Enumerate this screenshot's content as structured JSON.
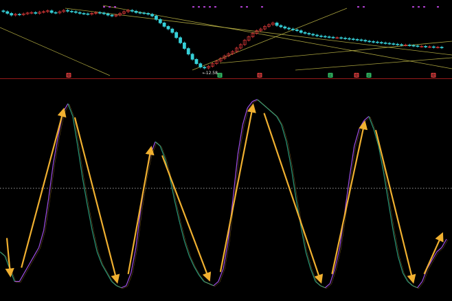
{
  "chart_data": [
    {
      "type": "candlestick",
      "panel": "price",
      "low_label": "12.58",
      "colors": {
        "up": "#e03a3a",
        "down": "#36d0d8",
        "trend_line": "#c8c04a",
        "divider": "#9b1b1b"
      },
      "close_series": [
        13.9,
        13.86,
        13.82,
        13.84,
        13.83,
        13.85,
        13.87,
        13.88,
        13.86,
        13.89,
        13.9,
        13.92,
        13.88,
        13.87,
        13.9,
        13.93,
        13.91,
        13.9,
        13.88,
        13.86,
        13.85,
        13.84,
        13.86,
        13.88,
        13.87,
        13.85,
        13.82,
        13.8,
        13.82,
        13.86,
        13.9,
        13.93,
        13.91,
        13.88,
        13.87,
        13.86,
        13.84,
        13.8,
        13.72,
        13.64,
        13.56,
        13.5,
        13.42,
        13.3,
        13.18,
        13.05,
        12.92,
        12.8,
        12.7,
        12.62,
        12.6,
        12.64,
        12.7,
        12.76,
        12.82,
        12.88,
        12.93,
        12.98,
        13.06,
        13.14,
        13.24,
        13.32,
        13.4,
        13.46,
        13.5,
        13.56,
        13.6,
        13.64,
        13.58,
        13.55,
        13.52,
        13.5,
        13.48,
        13.46,
        13.42,
        13.4,
        13.38,
        13.36,
        13.34,
        13.33,
        13.32,
        13.31,
        13.3,
        13.3,
        13.29,
        13.28,
        13.27,
        13.26,
        13.25,
        13.24,
        13.22,
        13.21,
        13.2,
        13.19,
        13.18,
        13.17,
        13.16,
        13.15,
        13.14,
        13.13,
        13.13,
        13.12,
        13.11,
        13.1,
        13.1,
        13.09,
        13.09,
        13.08,
        13.08,
        13.07
      ],
      "signal_markers": [
        {
          "text": "卖",
          "bg": "#e03a3a"
        },
        {
          "text": "买",
          "bg": "#34c76a"
        },
        {
          "text": "卖",
          "bg": "#e03a3a"
        },
        {
          "text": "买",
          "bg": "#34c76a"
        },
        {
          "text": "卖",
          "bg": "#e03a3a"
        },
        {
          "text": "买",
          "bg": "#34c76a"
        },
        {
          "text": "卖",
          "bg": "#e03a3a"
        }
      ]
    },
    {
      "type": "line",
      "panel": "oscillator",
      "ylim": [
        0,
        100
      ],
      "midline": 50,
      "midline_style": "dotted",
      "colors": {
        "rising": "#a050e8",
        "falling": "#2a9a7a",
        "arrow": "#f0b030"
      },
      "series": [
        {
          "values": [
            20,
            18,
            12,
            6,
            6,
            10,
            14,
            18,
            22,
            30,
            45,
            62,
            75,
            86,
            90,
            84,
            70,
            55,
            42,
            30,
            20,
            14,
            10,
            6,
            4,
            3,
            4,
            10,
            22,
            40,
            55,
            66,
            72,
            70,
            64,
            55,
            44,
            34,
            25,
            18,
            13,
            9,
            6,
            5,
            4,
            6,
            12,
            25,
            45,
            66,
            80,
            88,
            91,
            92,
            90,
            88,
            86,
            84,
            80,
            72,
            60,
            45,
            32,
            20,
            12,
            6,
            4,
            3,
            5,
            12,
            22,
            38,
            55,
            70,
            78,
            82,
            84,
            78,
            70,
            58,
            44,
            30,
            18,
            10,
            6,
            4,
            3,
            6,
            12,
            16,
            20,
            22,
            26
          ]
        }
      ]
    }
  ]
}
